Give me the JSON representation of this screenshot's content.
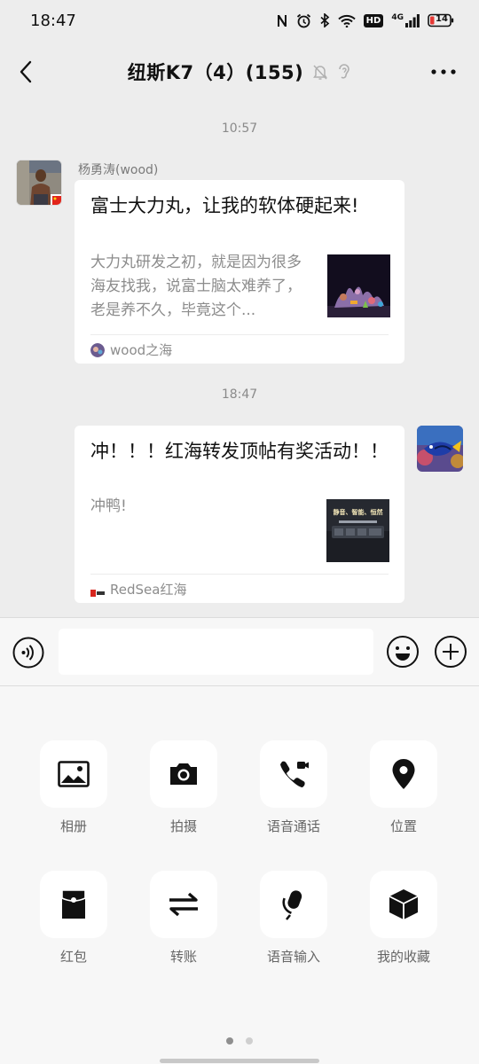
{
  "status_bar": {
    "time": "18:47",
    "hd_badge": "HD",
    "network": "4G",
    "battery": "14",
    "icons": [
      "nfc-icon",
      "alarm-icon",
      "bluetooth-icon",
      "wifi-icon",
      "hd-icon",
      "signal-icon",
      "battery-icon"
    ]
  },
  "header": {
    "title": "纽斯K7（4）(155)",
    "icons": [
      "back-icon",
      "mute-bell-icon",
      "ear-icon",
      "more-icon"
    ]
  },
  "chat": {
    "messages": [
      {
        "time": "10:57",
        "sender": "杨勇涛(wood)",
        "direction": "incoming",
        "title": "富士大力丸，让我的软体硬起来!",
        "description": "大力丸研发之初，就是因为很多海友找我，说富士脑太难养了，老是养不久，毕竟这个...",
        "source": "wood之海"
      },
      {
        "time": "18:47",
        "direction": "outgoing",
        "title": "冲！！！红海转发顶帖有奖活动！！",
        "description": "冲鸭!",
        "source": "RedSea红海",
        "thumb_text": "静音、智能、恒然"
      }
    ]
  },
  "input_bar": {
    "placeholder": "",
    "value": "",
    "icons": [
      "voice-icon",
      "emoji-icon",
      "plus-icon"
    ]
  },
  "tools": [
    {
      "label": "相册",
      "icon": "image-icon"
    },
    {
      "label": "拍摄",
      "icon": "camera-icon"
    },
    {
      "label": "语音通话",
      "icon": "phone-video-icon"
    },
    {
      "label": "位置",
      "icon": "location-pin-icon"
    },
    {
      "label": "红包",
      "icon": "red-packet-icon"
    },
    {
      "label": "转账",
      "icon": "transfer-icon"
    },
    {
      "label": "语音输入",
      "icon": "microphone-icon"
    },
    {
      "label": "我的收藏",
      "icon": "box-icon"
    }
  ],
  "pager": {
    "pages": 2,
    "current": 1
  }
}
